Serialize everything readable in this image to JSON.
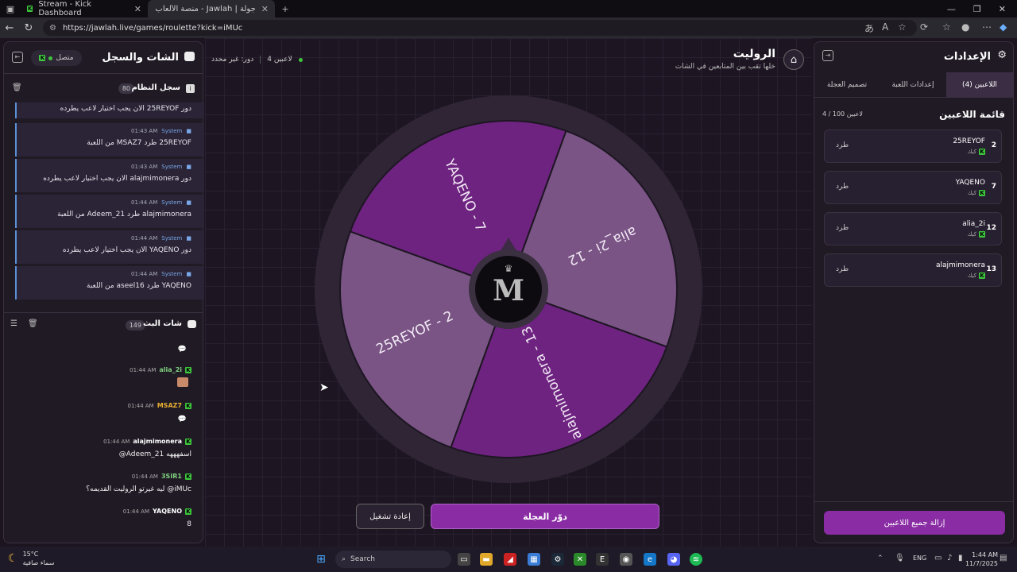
{
  "browser": {
    "tabs": [
      {
        "title": "Stream - Kick Dashboard"
      },
      {
        "title": "جولة | Jawlah - منصة الألعاب التفا"
      }
    ],
    "url": "https://jawlah.live/games/roulette?kick=iMUc"
  },
  "chat_panel": {
    "title": "الشات والسجل",
    "status_label": "متصل",
    "system_log": {
      "title": "سجل النظام",
      "count": "80",
      "entries": [
        {
          "text": "دور 25REYOF الان يجب اختيار لاعب يطرده",
          "time": "",
          "author": ""
        },
        {
          "author": "System",
          "time": "01:43 AM",
          "text": "25REYOF طرد MSAZ7 من اللعبة"
        },
        {
          "author": "System",
          "time": "01:43 AM",
          "text": "دور alajmimonera الان يجب اختيار لاعب يطرده"
        },
        {
          "author": "System",
          "time": "01:44 AM",
          "text": "alajmimonera طرد Adeem_21 من اللعبة"
        },
        {
          "author": "System",
          "time": "01:44 AM",
          "text": "دور YAQENO الان يجب اختيار لاعب يطرده"
        },
        {
          "author": "System",
          "time": "01:44 AM",
          "text": "YAQENO طرد aseel16 من اللعبة"
        }
      ]
    },
    "stream_chat": {
      "title": "شات البث",
      "count": "149",
      "messages": [
        {
          "user": "alia_2i",
          "time": "01:44 AM",
          "text": "",
          "user_color": "#7fd17f"
        },
        {
          "user": "MSAZ7",
          "time": "01:44 AM",
          "text": "",
          "user_color": "#e8b030"
        },
        {
          "user": "alajmimonera",
          "time": "01:44 AM",
          "text": "@Adeem_21 اسفهههه",
          "user_color": "#ffffff"
        },
        {
          "user": "3SIR1",
          "time": "01:44 AM",
          "text": "ليه غيرتو الروليت القديمه؟ @iMUc",
          "user_color": "#7fd17f"
        },
        {
          "user": "YAQENO",
          "time": "01:44 AM",
          "text": "8",
          "user_color": "#ffffff"
        }
      ]
    }
  },
  "game": {
    "title": "الروليت",
    "subtitle": "خلها تقب بين المتابعين في الشات",
    "players_badge": "4 لاعبين",
    "turn_label": "دور: غير محدد",
    "wheel_segments": [
      {
        "label": "YAQENO - 7",
        "color": "#6e2380"
      },
      {
        "label": "alia_2i - 12",
        "color": "#7a5485"
      },
      {
        "label": "alajmimonera - 13",
        "color": "#6e2380"
      },
      {
        "label": "25REYOF - 2",
        "color": "#7a5485"
      }
    ],
    "spin_button": "دوّر العجلة",
    "restart_button": "إعادة تشغيل"
  },
  "settings_panel": {
    "title": "الإعدادات",
    "tabs": [
      "اللاعبين (4)",
      "إعدادات اللعبة",
      "تصميم العجلة"
    ],
    "list_title": "قائمة اللاعبين",
    "list_count": "4 / 100 لاعبين",
    "players": [
      {
        "num": "2",
        "name": "25REYOF",
        "platform": "كيك",
        "action": "طرد"
      },
      {
        "num": "7",
        "name": "YAQENO",
        "platform": "كيك",
        "action": "طرد"
      },
      {
        "num": "12",
        "name": "alia_2i",
        "platform": "كيك",
        "action": "طرد"
      },
      {
        "num": "13",
        "name": "alajmimonera",
        "platform": "كيك",
        "action": "طرد"
      }
    ],
    "remove_all": "إزالة جميع اللاعبين"
  },
  "taskbar": {
    "weather_temp": "15°C",
    "weather_desc": "سماء صافية",
    "search": "Search",
    "lang": "ENG",
    "time": "1:44 AM",
    "date": "11/7/2025"
  }
}
